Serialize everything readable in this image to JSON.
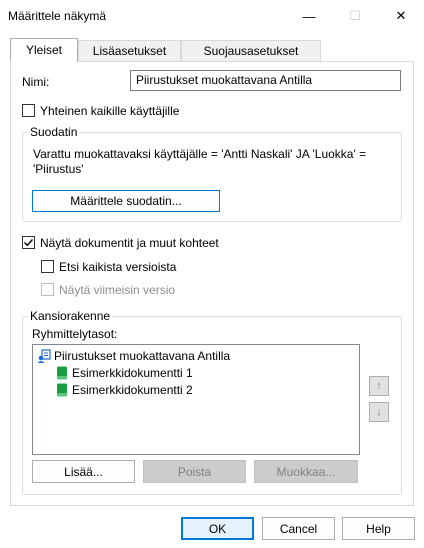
{
  "window": {
    "title": "Määrittele näkymä",
    "minimize_glyph": "—",
    "maximize_glyph": "☐",
    "close_glyph": "✕"
  },
  "tabs": [
    {
      "label": "Yleiset",
      "active": true
    },
    {
      "label": "Lisäasetukset",
      "active": false
    },
    {
      "label": "Suojausasetukset",
      "active": false
    }
  ],
  "general": {
    "name_label": "Nimi:",
    "name_value": "Piirustukset muokattavana Antilla",
    "shared_label": "Yhteinen kaikille käyttäjille",
    "shared_checked": false
  },
  "filter": {
    "legend": "Suodatin",
    "description": "Varattu muokattavaksi käyttäjälle = 'Antti Naskali' JA 'Luokka' = 'Piirustus'",
    "define_button": "Määrittele suodatin..."
  },
  "documents": {
    "show_label": "Näytä dokumentit ja muut kohteet",
    "show_checked": true,
    "search_all_label": "Etsi kaikista versioista",
    "search_all_checked": false,
    "show_latest_label": "Näytä viimeisin versio",
    "show_latest_checked": false,
    "show_latest_enabled": false
  },
  "folder_structure": {
    "legend": "Kansiorakenne",
    "grouping_label": "Ryhmittelytasot:",
    "tree": [
      {
        "label": "Piirustukset muokattavana Antilla",
        "level": 0,
        "icon": "view-icon"
      },
      {
        "label": "Esimerkkidokumentti 1",
        "level": 1,
        "icon": "document-icon"
      },
      {
        "label": "Esimerkkidokumentti 2",
        "level": 1,
        "icon": "document-icon"
      }
    ],
    "up_glyph": "↑",
    "down_glyph": "↓",
    "add_button": "Lisää...",
    "remove_button": "Poista",
    "edit_button": "Muokkaa..."
  },
  "footer": {
    "ok_button": "OK",
    "cancel_button": "Cancel",
    "help_button": "Help"
  },
  "colors": {
    "accent": "#0078d7",
    "view_icon": "#1e6fd9",
    "document_icon": "#1a9e3f"
  }
}
